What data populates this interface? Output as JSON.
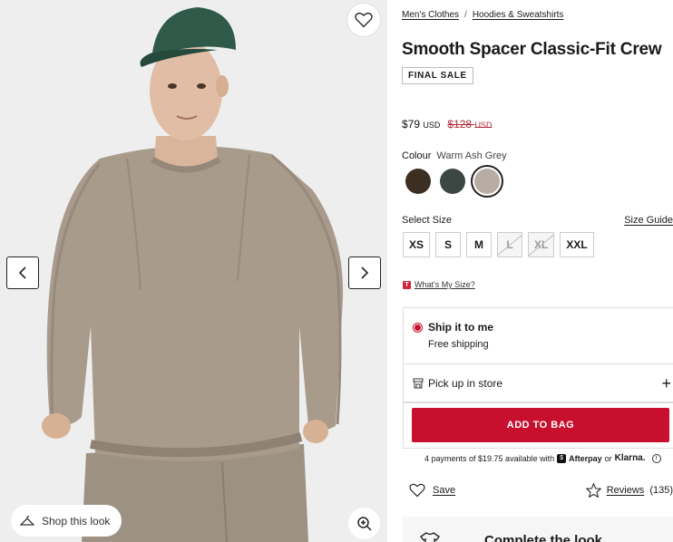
{
  "breadcrumb": {
    "items": [
      "Men's Clothes",
      "Hoodies & Sweatshirts"
    ],
    "separator": "/"
  },
  "product": {
    "title": "Smooth Spacer Classic-Fit Crew",
    "badge": "FINAL SALE",
    "price_now": "$79",
    "price_currency": "USD",
    "price_was": "$128",
    "price_was_currency": "USD"
  },
  "colour": {
    "label": "Colour",
    "selected": "Warm Ash Grey",
    "swatches": [
      {
        "name": "Brown",
        "hex": "#3d2e22"
      },
      {
        "name": "Dark Green",
        "hex": "#3c4643"
      },
      {
        "name": "Warm Ash Grey",
        "hex": "#b8aca3"
      }
    ]
  },
  "size": {
    "label": "Select Size",
    "guide": "Size Guide",
    "options": [
      {
        "label": "XS",
        "available": true
      },
      {
        "label": "S",
        "available": true
      },
      {
        "label": "M",
        "available": true
      },
      {
        "label": "L",
        "available": false
      },
      {
        "label": "XL",
        "available": false
      },
      {
        "label": "XXL",
        "available": true
      }
    ],
    "whats_my_size_badge": "T",
    "whats_my_size": "What's My Size?"
  },
  "fulfillment": {
    "ship_title": "Ship it to me",
    "ship_sub": "Free shipping",
    "pickup": "Pick up in store",
    "plus": "+"
  },
  "cta": {
    "add_to_bag": "ADD TO BAG"
  },
  "payments": {
    "text": "4 payments of $19.75 available with",
    "afterpay_glyph": "$",
    "afterpay": "Afterpay",
    "or": "or",
    "klarna": "Klarna.",
    "info": "i"
  },
  "actions": {
    "save": "Save",
    "reviews": "Reviews",
    "reviews_count": "(135)"
  },
  "complete_look": "Complete the look",
  "gallery": {
    "shop_look": "Shop this look"
  },
  "colors": {
    "accent": "#c8102e",
    "sweater": "#a89b8c",
    "cap": "#2f5a4a"
  }
}
